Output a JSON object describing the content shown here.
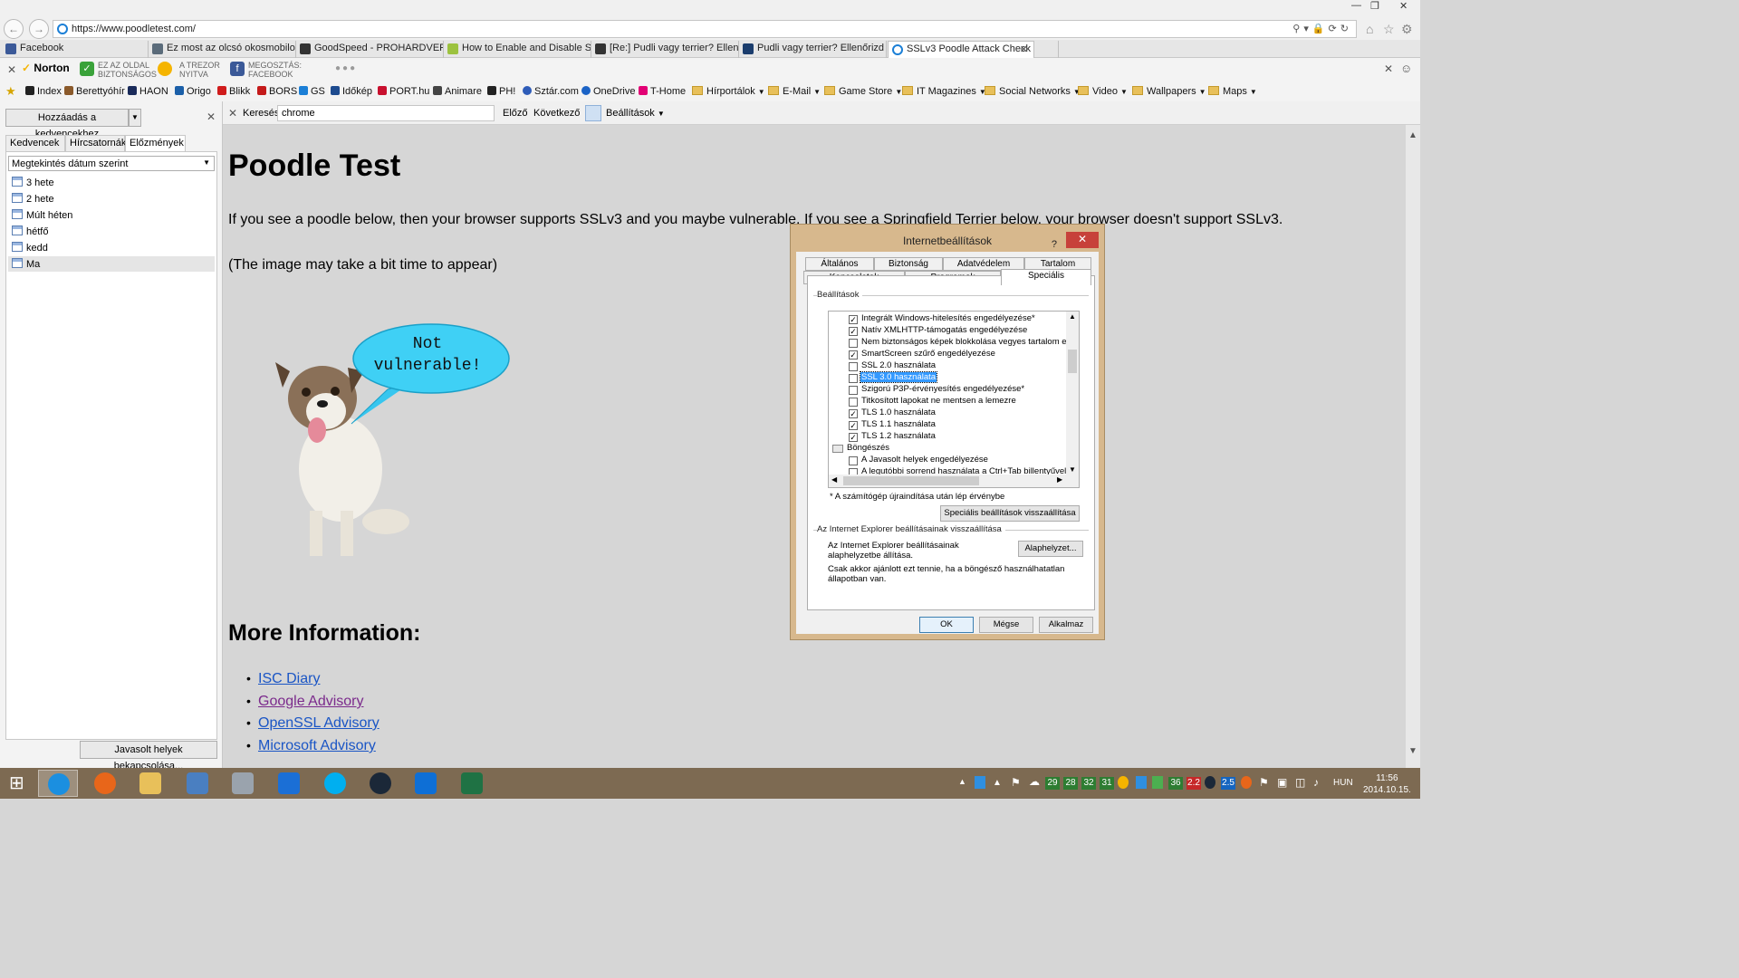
{
  "browser": {
    "url": "https://www.poodletest.com/",
    "tabs": [
      {
        "label": "Facebook",
        "color": "#3b5998"
      },
      {
        "label": "Ez most az olcsó okosmobilok ...",
        "color": "#5a6b7a"
      },
      {
        "label": "GoodSpeed - PROHARDVER! T...",
        "color": "#333333"
      },
      {
        "label": "How to Enable and Disable SSL...",
        "color": "#9cc23f"
      },
      {
        "label": "[Re:] Pudli vagy terrier? Ellenőri...",
        "color": "#333333"
      },
      {
        "label": "Pudli vagy terrier? Ellenőrizd a ...",
        "color": "#1b3d6d"
      },
      {
        "label": "SSLv3 Poodle Attack Check",
        "color": "#1b7fd6"
      }
    ]
  },
  "norton": {
    "brand": "Norton",
    "safe_line1": "EZ AZ OLDAL",
    "safe_line2": "BIZTONSÁGOS",
    "vault_line1": "A TREZOR",
    "vault_line2": "NYITVA",
    "share_line1": "MEGOSZTÁS:",
    "share_line2": "FACEBOOK"
  },
  "favorites_bar": [
    {
      "label": "Index",
      "icon": "index-icon",
      "color": "#222222"
    },
    {
      "label": "Berettyóhír",
      "icon": "pen-icon",
      "color": "#8b5a2b"
    },
    {
      "label": "HAON",
      "icon": "haon-icon",
      "color": "#1a2b5a"
    },
    {
      "label": "Origo",
      "icon": "origo-icon",
      "color": "#1b5fa8"
    },
    {
      "label": "Blikk",
      "icon": "blikk-icon",
      "color": "#d01c1c"
    },
    {
      "label": "BORS",
      "icon": "bors-icon",
      "color": "#c41a1a"
    },
    {
      "label": "GS",
      "icon": "gs-icon",
      "color": "#1b7fd6"
    },
    {
      "label": "Időkép",
      "icon": "idokep-icon",
      "color": "#1d4b8f"
    },
    {
      "label": "PORT.hu",
      "icon": "port-icon",
      "color": "#c8102e"
    },
    {
      "label": "Animare",
      "icon": "animare-icon",
      "color": "#444444"
    },
    {
      "label": "PH!",
      "icon": "ph-icon",
      "color": "#222222"
    },
    {
      "label": "Sztár.com",
      "icon": "sztar-icon",
      "color": "#2e5cb8"
    },
    {
      "label": "OneDrive",
      "icon": "cloud-icon",
      "color": "#1b63c6"
    },
    {
      "label": "T-Home",
      "icon": "t-icon",
      "color": "#e20074"
    }
  ],
  "favorite_folders": [
    "Hírportálok",
    "E-Mail",
    "Game Store",
    "IT Magazines",
    "Social Networks",
    "Video",
    "Wallpapers",
    "Maps"
  ],
  "find_bar": {
    "label": "Keresés:",
    "value": "chrome",
    "prev": "Előző",
    "next": "Következő",
    "options": "Beállítások"
  },
  "left_panel": {
    "add_button": "Hozzáadás a kedvencekhez",
    "tabs": [
      "Kedvencek",
      "Hírcsatornák",
      "Előzmények"
    ],
    "sort_select": "Megtekintés dátum szerint",
    "history": [
      "3 hete",
      "2 hete",
      "Múlt héten",
      "hétfő",
      "kedd",
      "Ma"
    ],
    "bottom_button": "Javasolt helyek bekapcsolása..."
  },
  "page": {
    "title": "Poodle Test",
    "intro": "If you see a poodle below, then your browser supports SSLv3 and you maybe vulnerable. If you see a Springfield Terrier below, your browser doesn't support SSLv3.",
    "note": "(The image may take a bit time to appear)",
    "bubble_line1": "Not",
    "bubble_line2": "vulnerable!",
    "more_title": "More Information:",
    "links": [
      "ISC Diary",
      "Google Advisory",
      "OpenSSL Advisory",
      "Microsoft Advisory"
    ]
  },
  "dialog": {
    "title": "Internetbeállítások",
    "help": "?",
    "tabs_top": [
      "Általános",
      "Biztonság",
      "Adatvédelem",
      "Tartalom"
    ],
    "tabs_bottom": [
      "Kapcsolatok",
      "Programok",
      "Speciális"
    ],
    "settings_group": "Beállítások",
    "settings": [
      {
        "label": "Integrált Windows-hitelesítés engedélyezése*",
        "checked": true
      },
      {
        "label": "Natív XMLHTTP-támogatás engedélyezése",
        "checked": true
      },
      {
        "label": "Nem biztonságos képek blokkolása vegyes tartalom esetén",
        "checked": false
      },
      {
        "label": "SmartScreen szűrő engedélyezése",
        "checked": true
      },
      {
        "label": "SSL 2.0 használata",
        "checked": false
      },
      {
        "label": "SSL 3.0 használata",
        "checked": false
      },
      {
        "label": "Szigorú P3P-érvényesítés engedélyezése*",
        "checked": false
      },
      {
        "label": "Titkosított lapokat ne mentsen a lemezre",
        "checked": false
      },
      {
        "label": "TLS 1.0 használata",
        "checked": true
      },
      {
        "label": "TLS 1.1 használata",
        "checked": true
      },
      {
        "label": "TLS 1.2 használata",
        "checked": true
      }
    ],
    "section_label": "Böngészés",
    "section_items": [
      {
        "label": "A Javasolt helyek engedélyezése",
        "checked": false
      },
      {
        "label": "A legutóbbi sorrend használata a Ctrl+Tab billentyűvel tör",
        "checked": false
      }
    ],
    "restart_note": "* A számítógép újraindítása után lép érvénybe",
    "restore_advanced": "Speciális beállítások visszaállítása",
    "reset_group": "Az Internet Explorer beállításainak visszaállítása",
    "reset_text": "Az Internet Explorer beállításainak alaphelyzetbe állítása.",
    "reset_button": "Alaphelyzet...",
    "reset_warning": "Csak akkor ajánlott ezt tennie, ha a böngésző használhatatlan állapotban van.",
    "ok": "OK",
    "cancel": "Mégse",
    "apply": "Alkalmaz"
  },
  "taskbar": {
    "apps": [
      {
        "name": "ie-icon",
        "color": "#1b8fe0"
      },
      {
        "name": "firefox-icon",
        "color": "#e8661a"
      },
      {
        "name": "explorer-icon",
        "color": "#e8c05a"
      },
      {
        "name": "control-panel-icon",
        "color": "#4a7fc1"
      },
      {
        "name": "network-icon",
        "color": "#9aa3ad"
      },
      {
        "name": "mail-icon",
        "color": "#1b6fd6"
      },
      {
        "name": "skype-icon",
        "color": "#00aff0"
      },
      {
        "name": "steam-icon",
        "color": "#1b2838"
      },
      {
        "name": "teamviewer-icon",
        "color": "#0e6fd6"
      },
      {
        "name": "excel-icon",
        "color": "#1f7244"
      }
    ],
    "tray_numbers": [
      {
        "value": "29",
        "color": "#2e7d32"
      },
      {
        "value": "28",
        "color": "#2e7d32"
      },
      {
        "value": "32",
        "color": "#2e7d32"
      },
      {
        "value": "31",
        "color": "#2e7d32"
      },
      {
        "value": "36",
        "color": "#2e7d32"
      },
      {
        "value": "2.2",
        "color": "#c62828"
      },
      {
        "value": "2.5",
        "color": "#1565c0"
      }
    ],
    "language": "HUN",
    "time": "11:56",
    "date": "2014.10.15."
  }
}
